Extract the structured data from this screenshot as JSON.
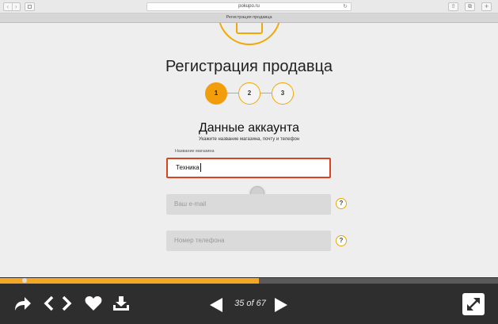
{
  "browser": {
    "nav_back": "‹",
    "nav_forward": "›",
    "url": "pokupo.ru",
    "reload_icon": "↻",
    "share_icon": "⇧",
    "tabs_icon": "⧉",
    "add_icon": "+",
    "tab_title": "Регистрация продавца"
  },
  "page": {
    "title": "Регистрация продавца",
    "steps": [
      "1",
      "2",
      "3"
    ],
    "active_step": 1,
    "section_title": "Данные аккаунта",
    "section_hint": "Укажите название магазина, почту и телефон",
    "store_name_label": "Название магазина",
    "store_name_value": "Техника",
    "email_placeholder": "Ваш e-mail",
    "phone_placeholder": "Номер телефона",
    "help_symbol": "?"
  },
  "player": {
    "progress_percent": 52,
    "counter": "35 of 67",
    "icons": [
      "share-icon",
      "embed-icon",
      "like-icon",
      "download-icon",
      "previous-icon",
      "next-icon",
      "fullscreen-icon"
    ]
  },
  "colors": {
    "accent": "#f29d0c",
    "error_border": "#d9431e"
  }
}
